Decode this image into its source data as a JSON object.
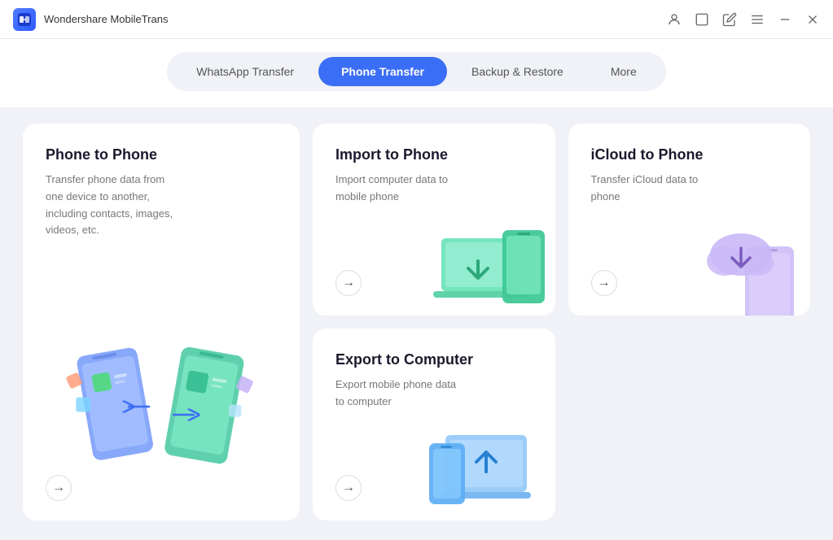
{
  "app": {
    "icon_label": "MT",
    "title": "Wondershare MobileTrans"
  },
  "titlebar": {
    "controls": [
      "account-icon",
      "window-icon",
      "edit-icon",
      "menu-icon",
      "minimize-icon",
      "close-icon"
    ]
  },
  "nav": {
    "tabs": [
      {
        "id": "whatsapp",
        "label": "WhatsApp Transfer",
        "active": false
      },
      {
        "id": "phone",
        "label": "Phone Transfer",
        "active": true
      },
      {
        "id": "backup",
        "label": "Backup & Restore",
        "active": false
      },
      {
        "id": "more",
        "label": "More",
        "active": false
      }
    ]
  },
  "cards": {
    "phone_to_phone": {
      "title": "Phone to Phone",
      "description": "Transfer phone data from one device to another, including contacts, images, videos, etc.",
      "arrow": "→"
    },
    "import_to_phone": {
      "title": "Import to Phone",
      "description": "Import computer data to mobile phone",
      "arrow": "→"
    },
    "icloud_to_phone": {
      "title": "iCloud to Phone",
      "description": "Transfer iCloud data to phone",
      "arrow": "→"
    },
    "export_to_computer": {
      "title": "Export to Computer",
      "description": "Export mobile phone data to computer",
      "arrow": "→"
    }
  },
  "colors": {
    "accent_blue": "#3b6ef6",
    "card_bg": "#ffffff",
    "background": "#f0f2f7"
  }
}
